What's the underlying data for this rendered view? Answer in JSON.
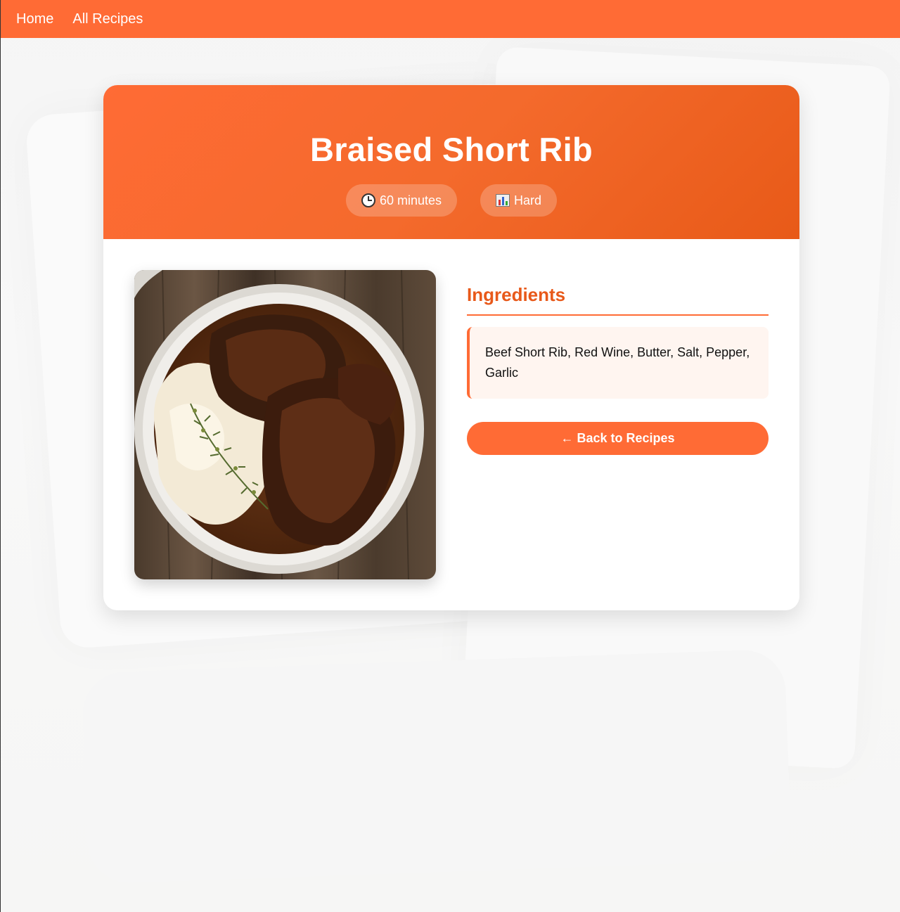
{
  "nav": {
    "home_label": "Home",
    "all_recipes_label": "All Recipes"
  },
  "recipe": {
    "title": "Braised Short Rib",
    "time_label": "60 minutes",
    "difficulty_label": "Hard",
    "ingredients_heading": "Ingredients",
    "ingredients_text": "Beef Short Rib, Red Wine, Butter, Salt, Pepper, Garlic",
    "back_button_label": "← Back to Recipes"
  },
  "icons": {
    "time": "clock-icon",
    "difficulty": "bar-chart-icon"
  },
  "colors": {
    "accent": "#ff6b35",
    "accent_dark": "#e8591a",
    "ingredients_bg": "#fff5f0"
  }
}
